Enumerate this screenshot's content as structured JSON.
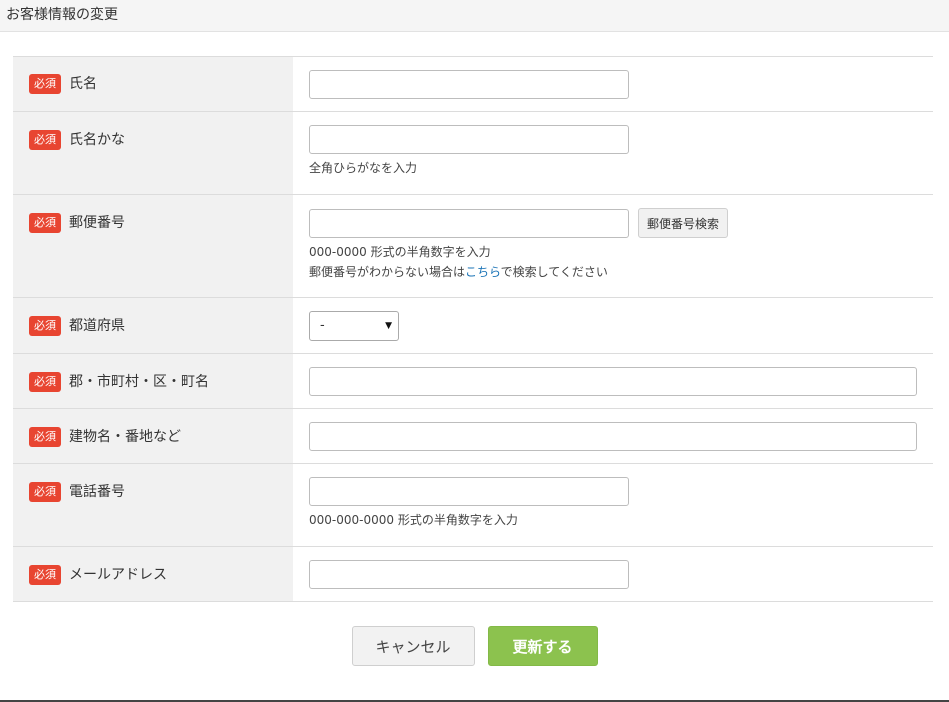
{
  "page": {
    "title": "お客様情報の変更"
  },
  "required_badge": "必須",
  "fields": {
    "name": {
      "label": "氏名",
      "value": ""
    },
    "name_kana": {
      "label": "氏名かな",
      "value": "",
      "hint": "全角ひらがなを入力"
    },
    "postal_code": {
      "label": "郵便番号",
      "value": "",
      "search_button": "郵便番号検索",
      "hint": "000-0000 形式の半角数字を入力",
      "help_prefix": "郵便番号がわからない場合は",
      "help_link": "こちら",
      "help_suffix": "で検索してください"
    },
    "prefecture": {
      "label": "都道府県",
      "selected": "-"
    },
    "city": {
      "label": "郡・市町村・区・町名",
      "value": ""
    },
    "address": {
      "label": "建物名・番地など",
      "value": ""
    },
    "phone": {
      "label": "電話番号",
      "value": "",
      "hint": "000-000-0000 形式の半角数字を入力"
    },
    "email": {
      "label": "メールアドレス",
      "value": ""
    }
  },
  "actions": {
    "cancel": "キャンセル",
    "submit": "更新する"
  },
  "colors": {
    "required_badge": "#e84531",
    "submit_button": "#8cc24e",
    "link": "#1a73b6",
    "label_background": "#f1f1f1"
  }
}
